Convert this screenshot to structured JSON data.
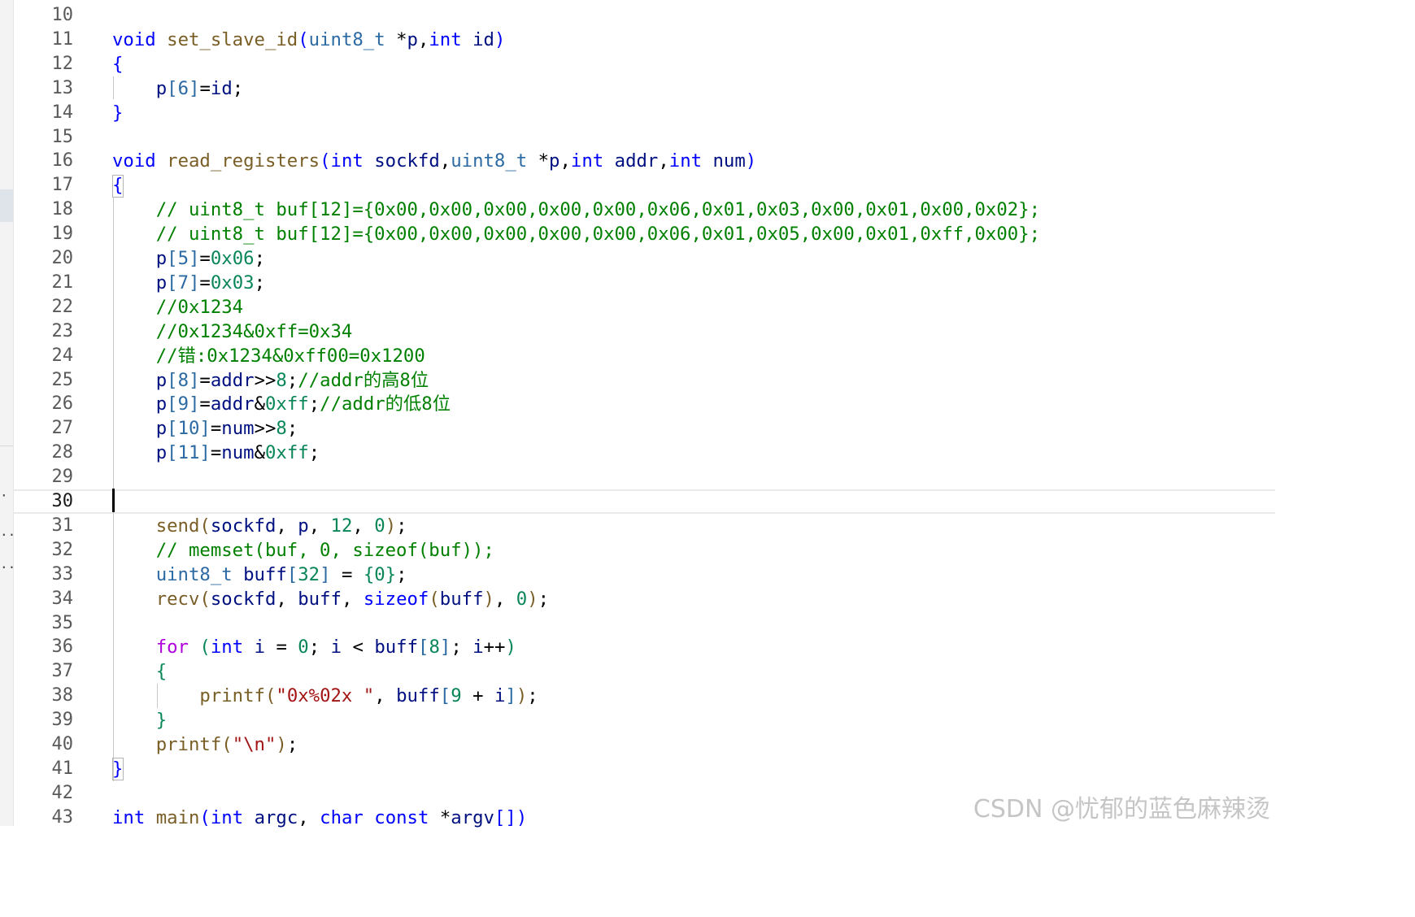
{
  "editor": {
    "current_line": "30",
    "lines": [
      {
        "number": "10",
        "tokens": []
      },
      {
        "number": "11",
        "tokens": [
          {
            "t": "void",
            "c": "kw"
          },
          {
            "t": " ",
            "c": "pn"
          },
          {
            "t": "set_slave_id",
            "c": "fn"
          },
          {
            "t": "(",
            "c": "kw"
          },
          {
            "t": "uint8_t",
            "c": "ty"
          },
          {
            "t": " *",
            "c": "pn"
          },
          {
            "t": "p",
            "c": "va"
          },
          {
            "t": ",",
            "c": "pn"
          },
          {
            "t": "int",
            "c": "kw"
          },
          {
            "t": " ",
            "c": "pn"
          },
          {
            "t": "id",
            "c": "va"
          },
          {
            "t": ")",
            "c": "kw"
          }
        ]
      },
      {
        "number": "12",
        "tokens": [
          {
            "t": "{",
            "c": "kw"
          }
        ]
      },
      {
        "number": "13",
        "tokens": [
          {
            "t": "    ",
            "c": "pn"
          },
          {
            "t": "p",
            "c": "va"
          },
          {
            "t": "[",
            "c": "ty"
          },
          {
            "t": "6",
            "c": "ty"
          },
          {
            "t": "]",
            "c": "ty"
          },
          {
            "t": "=",
            "c": "pn"
          },
          {
            "t": "id",
            "c": "va"
          },
          {
            "t": ";",
            "c": "pn"
          }
        ]
      },
      {
        "number": "14",
        "tokens": [
          {
            "t": "}",
            "c": "kw"
          }
        ]
      },
      {
        "number": "15",
        "tokens": []
      },
      {
        "number": "16",
        "tokens": [
          {
            "t": "void",
            "c": "kw"
          },
          {
            "t": " ",
            "c": "pn"
          },
          {
            "t": "read_registers",
            "c": "fn"
          },
          {
            "t": "(",
            "c": "kw"
          },
          {
            "t": "int",
            "c": "kw"
          },
          {
            "t": " ",
            "c": "pn"
          },
          {
            "t": "sockfd",
            "c": "va"
          },
          {
            "t": ",",
            "c": "pn"
          },
          {
            "t": "uint8_t",
            "c": "ty"
          },
          {
            "t": " *",
            "c": "pn"
          },
          {
            "t": "p",
            "c": "va"
          },
          {
            "t": ",",
            "c": "pn"
          },
          {
            "t": "int",
            "c": "kw"
          },
          {
            "t": " ",
            "c": "pn"
          },
          {
            "t": "addr",
            "c": "va"
          },
          {
            "t": ",",
            "c": "pn"
          },
          {
            "t": "int",
            "c": "kw"
          },
          {
            "t": " ",
            "c": "pn"
          },
          {
            "t": "num",
            "c": "va"
          },
          {
            "t": ")",
            "c": "kw"
          }
        ]
      },
      {
        "number": "17",
        "tokens": [
          {
            "t": "{",
            "c": "kw"
          }
        ]
      },
      {
        "number": "18",
        "tokens": [
          {
            "t": "    ",
            "c": "pn"
          },
          {
            "t": "// uint8_t buf[12]={0x00,0x00,0x00,0x00,0x00,0x06,0x01,0x03,0x00,0x01,0x00,0x02};",
            "c": "cm"
          }
        ]
      },
      {
        "number": "19",
        "tokens": [
          {
            "t": "    ",
            "c": "pn"
          },
          {
            "t": "// uint8_t buf[12]={0x00,0x00,0x00,0x00,0x00,0x06,0x01,0x05,0x00,0x01,0xff,0x00};",
            "c": "cm"
          }
        ]
      },
      {
        "number": "20",
        "tokens": [
          {
            "t": "    ",
            "c": "pn"
          },
          {
            "t": "p",
            "c": "va"
          },
          {
            "t": "[5]",
            "c": "ty"
          },
          {
            "t": "=",
            "c": "pn"
          },
          {
            "t": "0x06",
            "c": "nu"
          },
          {
            "t": ";",
            "c": "pn"
          }
        ]
      },
      {
        "number": "21",
        "tokens": [
          {
            "t": "    ",
            "c": "pn"
          },
          {
            "t": "p",
            "c": "va"
          },
          {
            "t": "[7]",
            "c": "ty"
          },
          {
            "t": "=",
            "c": "pn"
          },
          {
            "t": "0x03",
            "c": "nu"
          },
          {
            "t": ";",
            "c": "pn"
          }
        ]
      },
      {
        "number": "22",
        "tokens": [
          {
            "t": "    ",
            "c": "pn"
          },
          {
            "t": "//0x1234",
            "c": "cm"
          }
        ]
      },
      {
        "number": "23",
        "tokens": [
          {
            "t": "    ",
            "c": "pn"
          },
          {
            "t": "//0x1234&0xff=0x34",
            "c": "cm"
          }
        ]
      },
      {
        "number": "24",
        "tokens": [
          {
            "t": "    ",
            "c": "pn"
          },
          {
            "t": "//错:0x1234&0xff00=0x1200",
            "c": "cm"
          }
        ]
      },
      {
        "number": "25",
        "tokens": [
          {
            "t": "    ",
            "c": "pn"
          },
          {
            "t": "p",
            "c": "va"
          },
          {
            "t": "[8]",
            "c": "ty"
          },
          {
            "t": "=",
            "c": "pn"
          },
          {
            "t": "addr",
            "c": "va"
          },
          {
            "t": ">>",
            "c": "pn"
          },
          {
            "t": "8",
            "c": "nu"
          },
          {
            "t": ";",
            "c": "pn"
          },
          {
            "t": "//addr的高8位",
            "c": "cm"
          }
        ]
      },
      {
        "number": "26",
        "tokens": [
          {
            "t": "    ",
            "c": "pn"
          },
          {
            "t": "p",
            "c": "va"
          },
          {
            "t": "[9]",
            "c": "ty"
          },
          {
            "t": "=",
            "c": "pn"
          },
          {
            "t": "addr",
            "c": "va"
          },
          {
            "t": "&",
            "c": "pn"
          },
          {
            "t": "0xff",
            "c": "nu"
          },
          {
            "t": ";",
            "c": "pn"
          },
          {
            "t": "//addr的低8位",
            "c": "cm"
          }
        ]
      },
      {
        "number": "27",
        "tokens": [
          {
            "t": "    ",
            "c": "pn"
          },
          {
            "t": "p",
            "c": "va"
          },
          {
            "t": "[10]",
            "c": "ty"
          },
          {
            "t": "=",
            "c": "pn"
          },
          {
            "t": "num",
            "c": "va"
          },
          {
            "t": ">>",
            "c": "pn"
          },
          {
            "t": "8",
            "c": "nu"
          },
          {
            "t": ";",
            "c": "pn"
          }
        ]
      },
      {
        "number": "28",
        "tokens": [
          {
            "t": "    ",
            "c": "pn"
          },
          {
            "t": "p",
            "c": "va"
          },
          {
            "t": "[11]",
            "c": "ty"
          },
          {
            "t": "=",
            "c": "pn"
          },
          {
            "t": "num",
            "c": "va"
          },
          {
            "t": "&",
            "c": "pn"
          },
          {
            "t": "0xff",
            "c": "nu"
          },
          {
            "t": ";",
            "c": "pn"
          }
        ]
      },
      {
        "number": "29",
        "tokens": []
      },
      {
        "number": "30",
        "tokens": []
      },
      {
        "number": "31",
        "tokens": [
          {
            "t": "    ",
            "c": "pn"
          },
          {
            "t": "send",
            "c": "fn"
          },
          {
            "t": "(",
            "c": "fn"
          },
          {
            "t": "sockfd",
            "c": "va"
          },
          {
            "t": ", ",
            "c": "pn"
          },
          {
            "t": "p",
            "c": "va"
          },
          {
            "t": ", ",
            "c": "pn"
          },
          {
            "t": "12",
            "c": "nu"
          },
          {
            "t": ", ",
            "c": "pn"
          },
          {
            "t": "0",
            "c": "nu"
          },
          {
            "t": ")",
            "c": "fn"
          },
          {
            "t": ";",
            "c": "pn"
          }
        ]
      },
      {
        "number": "32",
        "tokens": [
          {
            "t": "    ",
            "c": "pn"
          },
          {
            "t": "// memset(buf, 0, sizeof(buf));",
            "c": "cm"
          }
        ]
      },
      {
        "number": "33",
        "tokens": [
          {
            "t": "    ",
            "c": "pn"
          },
          {
            "t": "uint8_t",
            "c": "ty"
          },
          {
            "t": " ",
            "c": "pn"
          },
          {
            "t": "buff",
            "c": "va"
          },
          {
            "t": "[",
            "c": "ty"
          },
          {
            "t": "32",
            "c": "nu"
          },
          {
            "t": "]",
            "c": "ty"
          },
          {
            "t": " = ",
            "c": "pn"
          },
          {
            "t": "{",
            "c": "nu"
          },
          {
            "t": "0",
            "c": "nu"
          },
          {
            "t": "}",
            "c": "nu"
          },
          {
            "t": ";",
            "c": "pn"
          }
        ]
      },
      {
        "number": "34",
        "tokens": [
          {
            "t": "    ",
            "c": "pn"
          },
          {
            "t": "recv",
            "c": "fn"
          },
          {
            "t": "(",
            "c": "fn"
          },
          {
            "t": "sockfd",
            "c": "va"
          },
          {
            "t": ", ",
            "c": "pn"
          },
          {
            "t": "buff",
            "c": "va"
          },
          {
            "t": ", ",
            "c": "pn"
          },
          {
            "t": "sizeof",
            "c": "kw"
          },
          {
            "t": "(",
            "c": "fn"
          },
          {
            "t": "buff",
            "c": "va"
          },
          {
            "t": ")",
            "c": "fn"
          },
          {
            "t": ", ",
            "c": "pn"
          },
          {
            "t": "0",
            "c": "nu"
          },
          {
            "t": ")",
            "c": "fn"
          },
          {
            "t": ";",
            "c": "pn"
          }
        ]
      },
      {
        "number": "35",
        "tokens": []
      },
      {
        "number": "36",
        "tokens": [
          {
            "t": "    ",
            "c": "pn"
          },
          {
            "t": "for",
            "c": "ct"
          },
          {
            "t": " ",
            "c": "pn"
          },
          {
            "t": "(",
            "c": "nu"
          },
          {
            "t": "int",
            "c": "kw"
          },
          {
            "t": " ",
            "c": "pn"
          },
          {
            "t": "i",
            "c": "va"
          },
          {
            "t": " = ",
            "c": "pn"
          },
          {
            "t": "0",
            "c": "nu"
          },
          {
            "t": "; ",
            "c": "pn"
          },
          {
            "t": "i",
            "c": "va"
          },
          {
            "t": " < ",
            "c": "pn"
          },
          {
            "t": "buff",
            "c": "va"
          },
          {
            "t": "[",
            "c": "ty"
          },
          {
            "t": "8",
            "c": "nu"
          },
          {
            "t": "]",
            "c": "ty"
          },
          {
            "t": "; ",
            "c": "pn"
          },
          {
            "t": "i",
            "c": "va"
          },
          {
            "t": "++",
            "c": "pn"
          },
          {
            "t": ")",
            "c": "nu"
          }
        ]
      },
      {
        "number": "37",
        "tokens": [
          {
            "t": "    ",
            "c": "pn"
          },
          {
            "t": "{",
            "c": "nu"
          }
        ]
      },
      {
        "number": "38",
        "tokens": [
          {
            "t": "        ",
            "c": "pn"
          },
          {
            "t": "printf",
            "c": "fn"
          },
          {
            "t": "(",
            "c": "fn"
          },
          {
            "t": "\"0x%02x \"",
            "c": "st"
          },
          {
            "t": ", ",
            "c": "pn"
          },
          {
            "t": "buff",
            "c": "va"
          },
          {
            "t": "[",
            "c": "ty"
          },
          {
            "t": "9",
            "c": "nu"
          },
          {
            "t": " + ",
            "c": "pn"
          },
          {
            "t": "i",
            "c": "va"
          },
          {
            "t": "]",
            "c": "ty"
          },
          {
            "t": ")",
            "c": "fn"
          },
          {
            "t": ";",
            "c": "pn"
          }
        ]
      },
      {
        "number": "39",
        "tokens": [
          {
            "t": "    ",
            "c": "pn"
          },
          {
            "t": "}",
            "c": "nu"
          }
        ]
      },
      {
        "number": "40",
        "tokens": [
          {
            "t": "    ",
            "c": "pn"
          },
          {
            "t": "printf",
            "c": "fn"
          },
          {
            "t": "(",
            "c": "fn"
          },
          {
            "t": "\"\\n\"",
            "c": "st"
          },
          {
            "t": ")",
            "c": "fn"
          },
          {
            "t": ";",
            "c": "pn"
          }
        ]
      },
      {
        "number": "41",
        "tokens": [
          {
            "t": "}",
            "c": "kw"
          }
        ]
      },
      {
        "number": "42",
        "tokens": []
      },
      {
        "number": "43",
        "tokens": [
          {
            "t": "int",
            "c": "kw"
          },
          {
            "t": " ",
            "c": "pn"
          },
          {
            "t": "main",
            "c": "fn"
          },
          {
            "t": "(",
            "c": "kw"
          },
          {
            "t": "int",
            "c": "kw"
          },
          {
            "t": " ",
            "c": "pn"
          },
          {
            "t": "argc",
            "c": "va"
          },
          {
            "t": ", ",
            "c": "pn"
          },
          {
            "t": "char",
            "c": "kw"
          },
          {
            "t": " ",
            "c": "pn"
          },
          {
            "t": "const",
            "c": "kw"
          },
          {
            "t": " *",
            "c": "pn"
          },
          {
            "t": "argv",
            "c": "va"
          },
          {
            "t": "[]",
            "c": "kw"
          },
          {
            "t": ")",
            "c": "kw"
          }
        ]
      }
    ]
  },
  "watermark": "CSDN @忧郁的蓝色麻辣烫"
}
